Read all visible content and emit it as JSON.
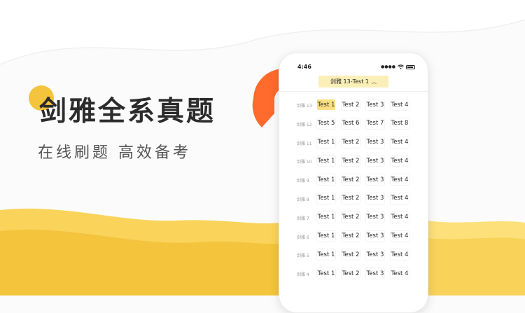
{
  "headline": "剑雅全系真题",
  "subline": "在线刷题 高效备考",
  "colors": {
    "accent_yellow": "#f4c43c",
    "accent_orange": "#ff6b2c",
    "selected_bg": "#fae081",
    "selector_bg": "#fbefb8"
  },
  "phone": {
    "status_time": "4:46",
    "selector_label": "剑雅 13-Test 1",
    "selector_icon": "chevron-up-icon",
    "rows": [
      {
        "label": "剑雅 13",
        "tests": [
          "Test 1",
          "Test 2",
          "Test 3",
          "Test 4"
        ],
        "selected": 0
      },
      {
        "label": "剑雅 12",
        "tests": [
          "Test 5",
          "Test 6",
          "Test 7",
          "Test 8"
        ],
        "selected": -1
      },
      {
        "label": "剑雅 11",
        "tests": [
          "Test 1",
          "Test 2",
          "Test 3",
          "Test 4"
        ],
        "selected": -1
      },
      {
        "label": "剑雅 10",
        "tests": [
          "Test 1",
          "Test 2",
          "Test 3",
          "Test 4"
        ],
        "selected": -1
      },
      {
        "label": "剑雅 9",
        "tests": [
          "Test 1",
          "Test 2",
          "Test 3",
          "Test 4"
        ],
        "selected": -1
      },
      {
        "label": "剑雅 8",
        "tests": [
          "Test 1",
          "Test 2",
          "Test 3",
          "Test 4"
        ],
        "selected": -1
      },
      {
        "label": "剑雅 7",
        "tests": [
          "Test 1",
          "Test 2",
          "Test 3",
          "Test 4"
        ],
        "selected": -1
      },
      {
        "label": "剑雅 6",
        "tests": [
          "Test 1",
          "Test 2",
          "Test 3",
          "Test 4"
        ],
        "selected": -1
      },
      {
        "label": "剑雅 5",
        "tests": [
          "Test 1",
          "Test 2",
          "Test 3",
          "Test 4"
        ],
        "selected": -1
      },
      {
        "label": "剑雅 4",
        "tests": [
          "Test 1",
          "Test 2",
          "Test 3",
          "Test 4"
        ],
        "selected": -1
      }
    ]
  }
}
